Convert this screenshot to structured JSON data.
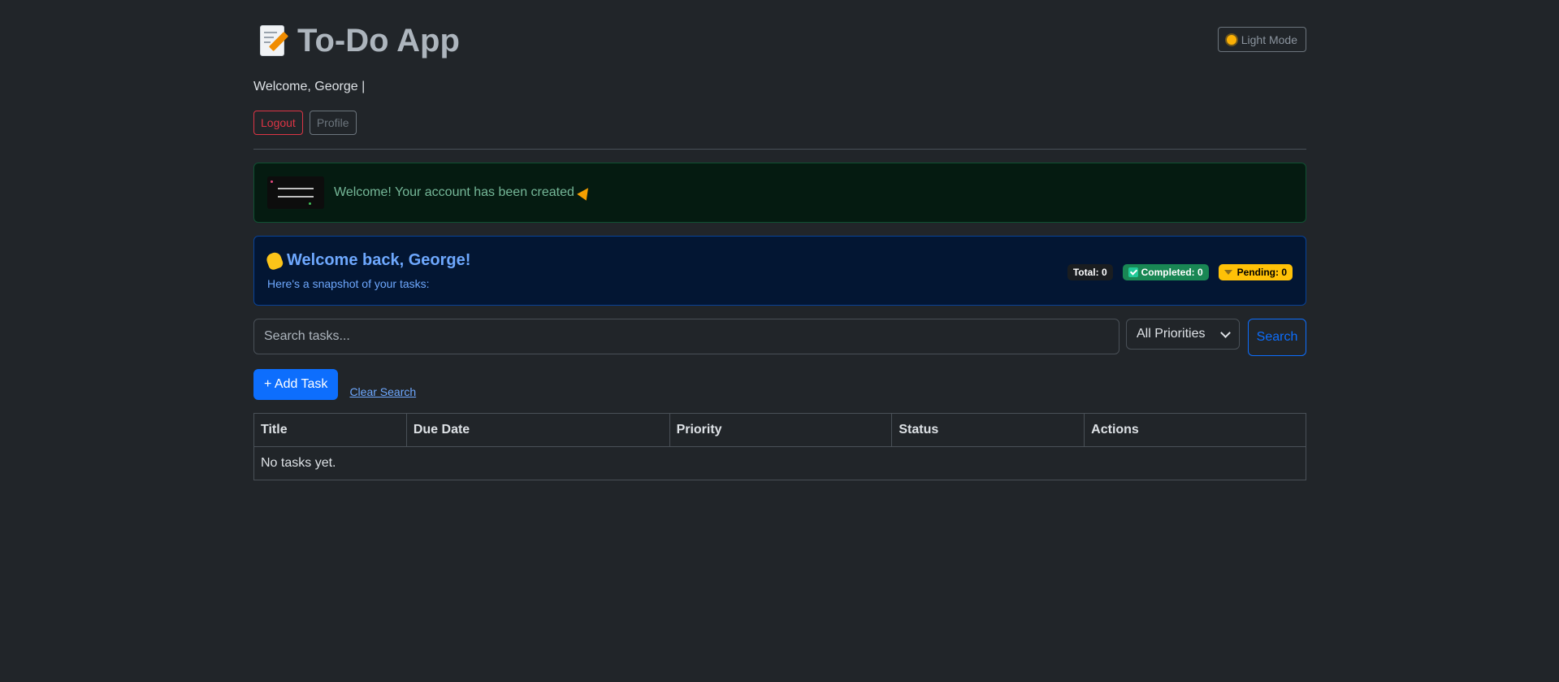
{
  "header": {
    "title": "To-Do App",
    "theme_toggle_label": "Light Mode"
  },
  "user": {
    "welcome_text": "Welcome, George |",
    "logout_label": "Logout",
    "profile_label": "Profile"
  },
  "flash": {
    "message": "Welcome! Your account has been created",
    "image_caption": "THIS CONTENT IS NOT AVAILABLE"
  },
  "summary": {
    "heading": "Welcome back, George!",
    "subtext": "Here's a snapshot of your tasks:",
    "badges": {
      "total": "Total: 0",
      "completed": "Completed: 0",
      "pending": "Pending: 0"
    }
  },
  "search": {
    "placeholder": "Search tasks...",
    "priority_selected": "All Priorities",
    "button_label": "Search"
  },
  "actions": {
    "add_task_label": "+ Add Task",
    "clear_search_label": "Clear Search"
  },
  "table": {
    "columns": [
      "Title",
      "Due Date",
      "Priority",
      "Status",
      "Actions"
    ],
    "empty_message": "No tasks yet."
  },
  "colors": {
    "background": "#212529",
    "primary": "#0d6efd",
    "danger": "#dc3545",
    "success": "#198754",
    "warning": "#ffc107"
  },
  "icons": [
    "memo-icon",
    "sun-icon",
    "party-popper-icon",
    "waving-hand-icon",
    "check-icon",
    "hourglass-icon",
    "chevron-down-icon"
  ]
}
